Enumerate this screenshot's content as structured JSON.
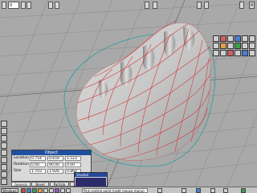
{
  "toolbar": {
    "frame_value": "0"
  },
  "object_panel": {
    "title": "Object",
    "rows": [
      {
        "label": "Location",
        "values": [
          "0.754",
          "0.659",
          "1.523"
        ]
      },
      {
        "label": "Rotation",
        "values": [
          "0.00",
          "90.00",
          "0.00"
        ]
      },
      {
        "label": "Size",
        "values": [
          "1.703",
          "1.926",
          "0.860"
        ]
      }
    ],
    "tabs": [
      "General",
      "Bevel",
      "Particle",
      "Relief"
    ]
  },
  "mini_window": {
    "title": "Shaded"
  },
  "status_bar": {
    "start_label": "Windows 98",
    "prompt_text": "Pick control point (right mouse menu)"
  },
  "colors": {
    "viewport_bg": "#a9a9a9",
    "grid": "#8f8f8f",
    "wireframe": "#d23a3a",
    "cage": "#2a9c9c",
    "surface": "#cfcfcf",
    "panel_title": "#1f4fa0"
  }
}
